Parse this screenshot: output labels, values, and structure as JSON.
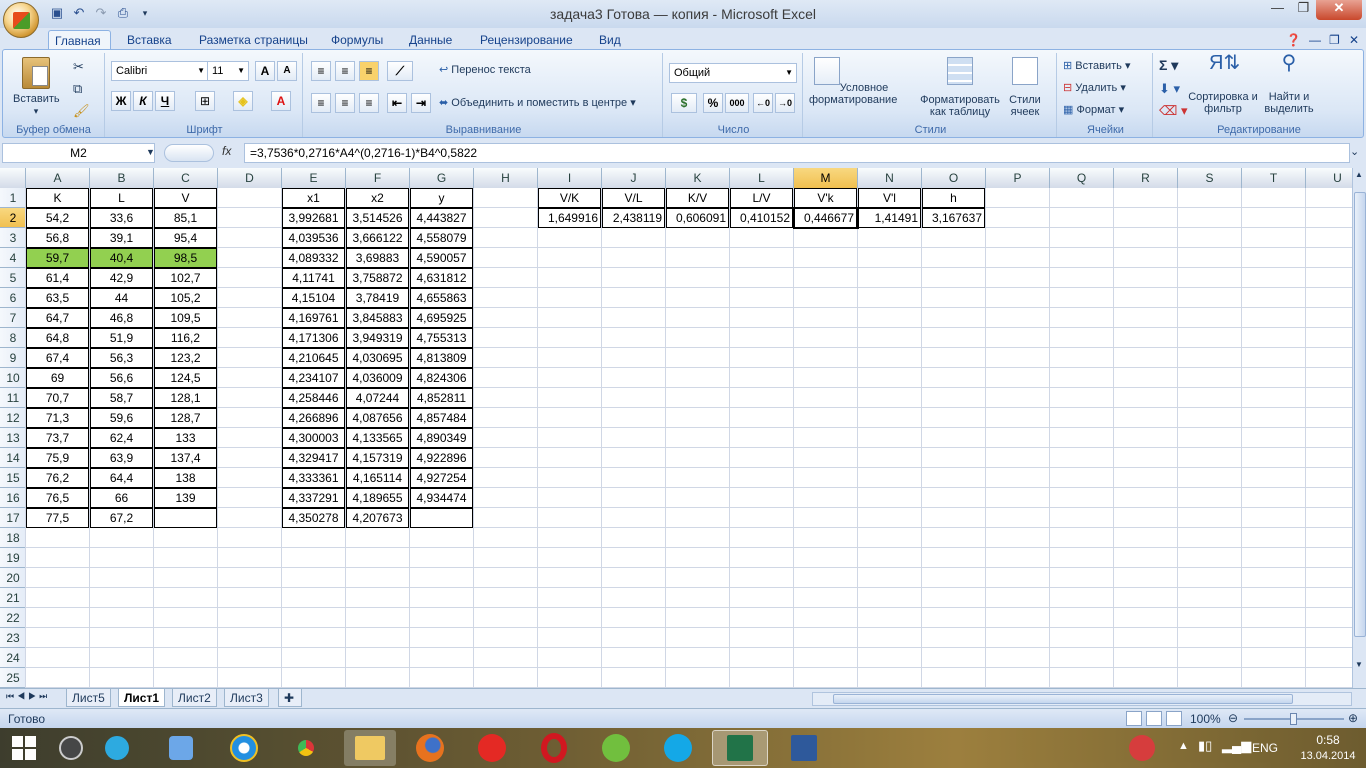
{
  "window": {
    "title": "задача3 Готова — копия - Microsoft Excel",
    "min": "—",
    "max": "❐",
    "close": "✕"
  },
  "tabs": [
    "Главная",
    "Вставка",
    "Разметка страницы",
    "Формулы",
    "Данные",
    "Рецензирование",
    "Вид"
  ],
  "ribbon": {
    "clipboard": {
      "paste": "Вставить",
      "label": "Буфер обмена"
    },
    "font": {
      "name": "Calibri",
      "size": "11",
      "bold": "Ж",
      "italic": "К",
      "underline": "Ч",
      "label": "Шрифт"
    },
    "align": {
      "wrap": "Перенос текста",
      "merge": "Объединить и поместить в центре",
      "label": "Выравнивание"
    },
    "number": {
      "format": "Общий",
      "percent": "%",
      "thousands": "000",
      "label": "Число"
    },
    "styles": {
      "cond": "Условное форматирование",
      "table": "Форматировать как таблицу",
      "cell": "Стили ячеек",
      "label": "Стили"
    },
    "cells": {
      "insert": "Вставить",
      "delete": "Удалить",
      "format": "Формат",
      "label": "Ячейки"
    },
    "editing": {
      "sort": "Сортировка и фильтр",
      "find": "Найти и выделить",
      "label": "Редактирование"
    }
  },
  "formula": {
    "namebox": "M2",
    "fx": "fx",
    "value": "=3,7536*0,2716*A4^(0,2716-1)*B4^0,5822"
  },
  "columns": [
    "A",
    "B",
    "C",
    "D",
    "E",
    "F",
    "G",
    "H",
    "I",
    "J",
    "K",
    "L",
    "M",
    "N",
    "O",
    "P",
    "Q",
    "R",
    "S",
    "T",
    "U"
  ],
  "rows": [
    "1",
    "2",
    "3",
    "4",
    "5",
    "6",
    "7",
    "8",
    "9",
    "10",
    "11",
    "12",
    "13",
    "14",
    "15",
    "16",
    "17",
    "18",
    "19",
    "20",
    "21",
    "22",
    "23",
    "24",
    "25"
  ],
  "table1": {
    "headers": [
      "K",
      "L",
      "V"
    ],
    "data": [
      [
        "54,2",
        "33,6",
        "85,1"
      ],
      [
        "56,8",
        "39,1",
        "95,4"
      ],
      [
        "59,7",
        "40,4",
        "98,5"
      ],
      [
        "61,4",
        "42,9",
        "102,7"
      ],
      [
        "63,5",
        "44",
        "105,2"
      ],
      [
        "64,7",
        "46,8",
        "109,5"
      ],
      [
        "64,8",
        "51,9",
        "116,2"
      ],
      [
        "67,4",
        "56,3",
        "123,2"
      ],
      [
        "69",
        "56,6",
        "124,5"
      ],
      [
        "70,7",
        "58,7",
        "128,1"
      ],
      [
        "71,3",
        "59,6",
        "128,7"
      ],
      [
        "73,7",
        "62,4",
        "133"
      ],
      [
        "75,9",
        "63,9",
        "137,4"
      ],
      [
        "76,2",
        "64,4",
        "138"
      ],
      [
        "76,5",
        "66",
        "139"
      ],
      [
        "77,5",
        "67,2",
        ""
      ]
    ]
  },
  "table2": {
    "headers": [
      "x1",
      "x2",
      "y"
    ],
    "data": [
      [
        "3,992681",
        "3,514526",
        "4,443827"
      ],
      [
        "4,039536",
        "3,666122",
        "4,558079"
      ],
      [
        "4,089332",
        "3,69883",
        "4,590057"
      ],
      [
        "4,11741",
        "3,758872",
        "4,631812"
      ],
      [
        "4,15104",
        "3,78419",
        "4,655863"
      ],
      [
        "4,169761",
        "3,845883",
        "4,695925"
      ],
      [
        "4,171306",
        "3,949319",
        "4,755313"
      ],
      [
        "4,210645",
        "4,030695",
        "4,813809"
      ],
      [
        "4,234107",
        "4,036009",
        "4,824306"
      ],
      [
        "4,258446",
        "4,07244",
        "4,852811"
      ],
      [
        "4,266896",
        "4,087656",
        "4,857484"
      ],
      [
        "4,300003",
        "4,133565",
        "4,890349"
      ],
      [
        "4,329417",
        "4,157319",
        "4,922896"
      ],
      [
        "4,333361",
        "4,165114",
        "4,927254"
      ],
      [
        "4,337291",
        "4,189655",
        "4,934474"
      ],
      [
        "4,350278",
        "4,207673",
        ""
      ]
    ]
  },
  "table3": {
    "headers": [
      "V/K",
      "V/L",
      "K/V",
      "L/V",
      "V'k",
      "V'l",
      "h"
    ],
    "data": [
      "1,649916",
      "2,438119",
      "0,606091",
      "0,410152",
      "0,446677",
      "1,41491",
      "3,167637"
    ]
  },
  "sheets": [
    "Лист5",
    "Лист1",
    "Лист2",
    "Лист3"
  ],
  "status": {
    "ready": "Готово",
    "zoom": "100%"
  },
  "taskbar": {
    "lang": "ENG",
    "time": "0:58",
    "date": "13.04.2014"
  }
}
